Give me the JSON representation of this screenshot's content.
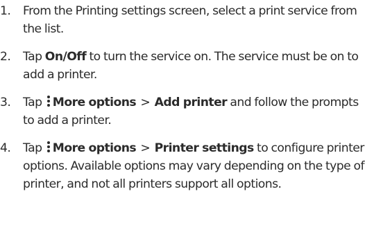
{
  "steps": [
    {
      "number": "1.",
      "text": "From the Printing settings screen, select a print service from the list."
    },
    {
      "number": "2.",
      "prefix": "Tap ",
      "bold": "On/Off",
      "suffix": " to turn the service on. The service must be on to add a printer."
    },
    {
      "number": "3.",
      "prefix": "Tap ",
      "icon": "more-options-icon",
      "bold1": "More options",
      "arrow": ">",
      "bold2": "Add printer",
      "suffix": " and follow the prompts to add a printer."
    },
    {
      "number": "4.",
      "prefix": "Tap ",
      "icon": "more-options-icon",
      "bold1": "More options",
      "arrow": ">",
      "bold2": "Printer settings",
      "suffix": " to configure printer options. Available options may vary depending on the type of printer, and not all printers support all options."
    }
  ]
}
